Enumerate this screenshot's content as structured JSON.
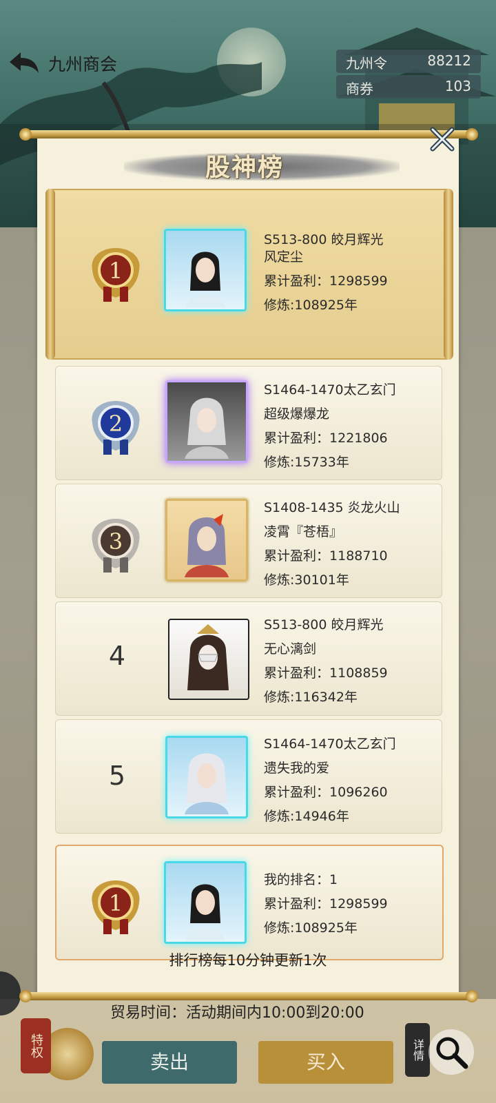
{
  "header": {
    "title": "九州商会",
    "currencies": [
      {
        "label": "九州令",
        "value": "88212"
      },
      {
        "label": "商券",
        "value": "103"
      }
    ]
  },
  "popup": {
    "title": "股神榜",
    "entries": [
      {
        "rank": "1",
        "server": "S513-800 皎月辉光",
        "name": "风定尘",
        "profit_label": "累计盈利：",
        "profit": "1298599",
        "cultivation": "修炼:108925年"
      },
      {
        "rank": "2",
        "server": "S1464-1470太乙玄门",
        "name": "超级爆爆龙",
        "profit_label": "累计盈利：",
        "profit": "1221806",
        "cultivation": "修炼:15733年"
      },
      {
        "rank": "3",
        "server": "S1408-1435 炎龙火山",
        "name": "凌霄『苍梧』",
        "profit_label": "累计盈利：",
        "profit": "1188710",
        "cultivation": "修炼:30101年"
      },
      {
        "rank": "4",
        "server": "S513-800 皎月辉光",
        "name": "无心漓剑",
        "profit_label": "累计盈利：",
        "profit": "1108859",
        "cultivation": "修炼:116342年"
      },
      {
        "rank": "5",
        "server": "S1464-1470太乙玄门",
        "name": "遗失我的爱",
        "profit_label": "累计盈利：",
        "profit": "1096260",
        "cultivation": "修炼:14946年"
      }
    ],
    "mine": {
      "rank": "1",
      "rank_text": "我的排名：1",
      "profit_text": "累计盈利：1298599",
      "cultivation": "修炼:108925年"
    },
    "footer": "排行榜每10分钟更新1次"
  },
  "bottom": {
    "trade_time": "贸易时间：活动期间内10:00到20:00",
    "sell_label": "卖出",
    "buy_label": "买入",
    "privilege_label": "特权",
    "detail_label": "详情"
  },
  "colors": {
    "gold": "#c9a24a",
    "panel": "#f6f1dd",
    "teal": "#3f6a6b"
  }
}
